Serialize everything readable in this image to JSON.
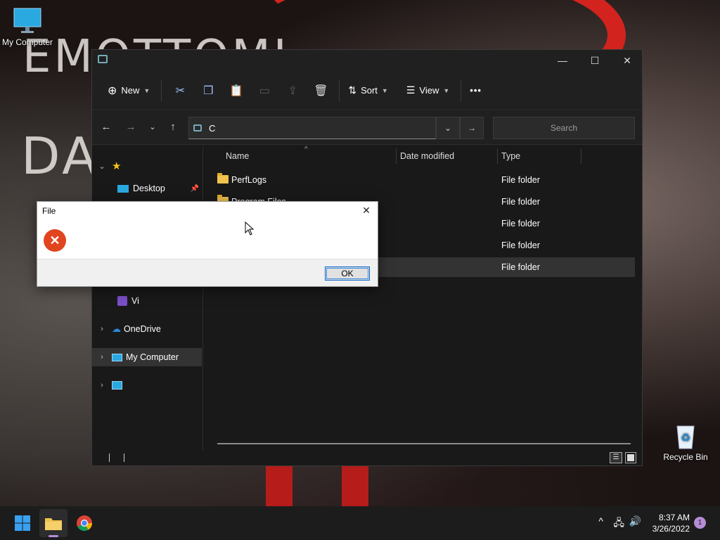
{
  "desktop": {
    "bg_text_1": "EMOTTOMI",
    "bg_text_2": "DA",
    "icons": [
      {
        "label": "My Computer",
        "icon": "monitor-icon"
      },
      {
        "label": "Recycle Bin",
        "icon": "recycle-bin-icon"
      }
    ]
  },
  "explorer": {
    "window_controls": {
      "minimize": "—",
      "maximize": "☐",
      "close": "✕"
    },
    "toolbar": {
      "new_label": "New",
      "sort_label": "Sort",
      "view_label": "View",
      "more_label": "•••",
      "icons": [
        "cut-icon",
        "copy-icon",
        "paste-icon",
        "rename-icon",
        "share-icon",
        "delete-icon"
      ]
    },
    "address": {
      "path": "C",
      "search_placeholder": "Search"
    },
    "nav_pane": {
      "quick_access_icon": "star-icon",
      "items": [
        {
          "label": "Desktop",
          "pinned": true
        },
        {
          "label": "Vi"
        },
        {
          "label": "OneDrive"
        },
        {
          "label": "My Computer"
        },
        {
          "label": ""
        }
      ]
    },
    "columns": [
      "Name",
      "Date modified",
      "Type"
    ],
    "rows": [
      {
        "name": "PerfLogs",
        "type": "File folder"
      },
      {
        "name": "Program Files",
        "type": "File folder"
      },
      {
        "name": "",
        "type": "File folder"
      },
      {
        "name": "",
        "type": "File folder"
      },
      {
        "name": "",
        "type": "File folder"
      }
    ]
  },
  "dialog": {
    "title": "File",
    "message": "",
    "ok_label": "OK",
    "close_glyph": "✕"
  },
  "taskbar": {
    "time": "8:37 AM",
    "date": "3/26/2022",
    "notification_count": "1",
    "apps": [
      "start-icon",
      "file-explorer-icon",
      "chrome-icon"
    ]
  },
  "colors": {
    "accent": "#0a64c8",
    "error": "#e0451f",
    "folder": "#f1c24e"
  }
}
